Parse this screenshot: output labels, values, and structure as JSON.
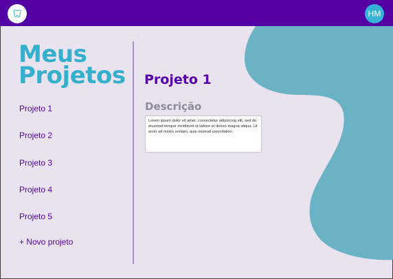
{
  "header": {
    "logo_label": "Logo",
    "avatar_initials": "HM"
  },
  "sidebar": {
    "title_line1": "Meus",
    "title_line2": "Projetos",
    "projects": [
      {
        "label": "Projeto 1"
      },
      {
        "label": "Projeto 2"
      },
      {
        "label": "Projeto 3"
      },
      {
        "label": "Projeto 4"
      },
      {
        "label": "Projeto 5"
      }
    ],
    "new_project_label": "+ Novo projeto"
  },
  "main": {
    "project_title": "Projeto 1",
    "description_label": "Descrição",
    "description_text": "Lorem ipsum dolor sit amet, consectetur adipiscing elit, sed do eiusmod tempor incididunt ut labore et dolore magna aliqua. Ut enim ad minim veniam, quis nostrud exercitation."
  },
  "colors": {
    "header_bg": "#5200a6",
    "page_bg": "#e9e2ef",
    "accent": "#35b0cc",
    "blob": "#6ab3c4",
    "link": "#5200a6",
    "divider": "#a98ed0"
  },
  "icons": {
    "logo": "tooth-logo-icon"
  }
}
